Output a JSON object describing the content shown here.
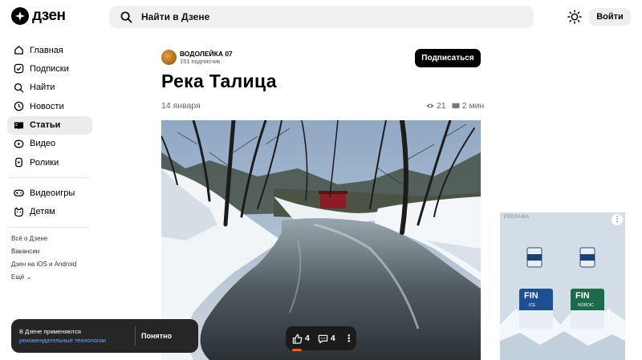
{
  "header": {
    "logo_text": "дзен",
    "search_placeholder": "Найти в Дзене",
    "login_label": "Войти"
  },
  "sidebar": {
    "items": [
      {
        "label": "Главная",
        "icon": "home-icon"
      },
      {
        "label": "Подписки",
        "icon": "subscriptions-icon"
      },
      {
        "label": "Найти",
        "icon": "search-icon"
      },
      {
        "label": "Новости",
        "icon": "news-icon"
      },
      {
        "label": "Статьи",
        "icon": "articles-icon",
        "active": true
      },
      {
        "label": "Видео",
        "icon": "video-icon"
      },
      {
        "label": "Ролики",
        "icon": "shorts-icon"
      },
      {
        "label": "Видеоигры",
        "icon": "gamepad-icon"
      },
      {
        "label": "Детям",
        "icon": "kids-icon"
      }
    ],
    "footer_links": [
      "Всё о Дзене",
      "Вакансии",
      "Дзен на iOS и Android",
      "Ещё"
    ]
  },
  "article": {
    "author": "ВОДОЛЕЙКА 07",
    "subscribers": "151 подписчик",
    "subscribe_label": "Подписаться",
    "title": "Река Талица",
    "date": "14 января",
    "views": "21",
    "read_time": "2 мин",
    "likes": "4",
    "comments": "4"
  },
  "cookie_banner": {
    "text": "В Дзене применяются",
    "link": "рекомендательные технологии",
    "button": "Понятно"
  },
  "ad": {
    "label": "РЕКЛАМА",
    "brand": "FIN",
    "products": [
      "ICE",
      "NORDIC"
    ]
  },
  "colors": {
    "accent": "#000000",
    "link": "#6aa7ff",
    "progress": "#ff5a1f"
  }
}
